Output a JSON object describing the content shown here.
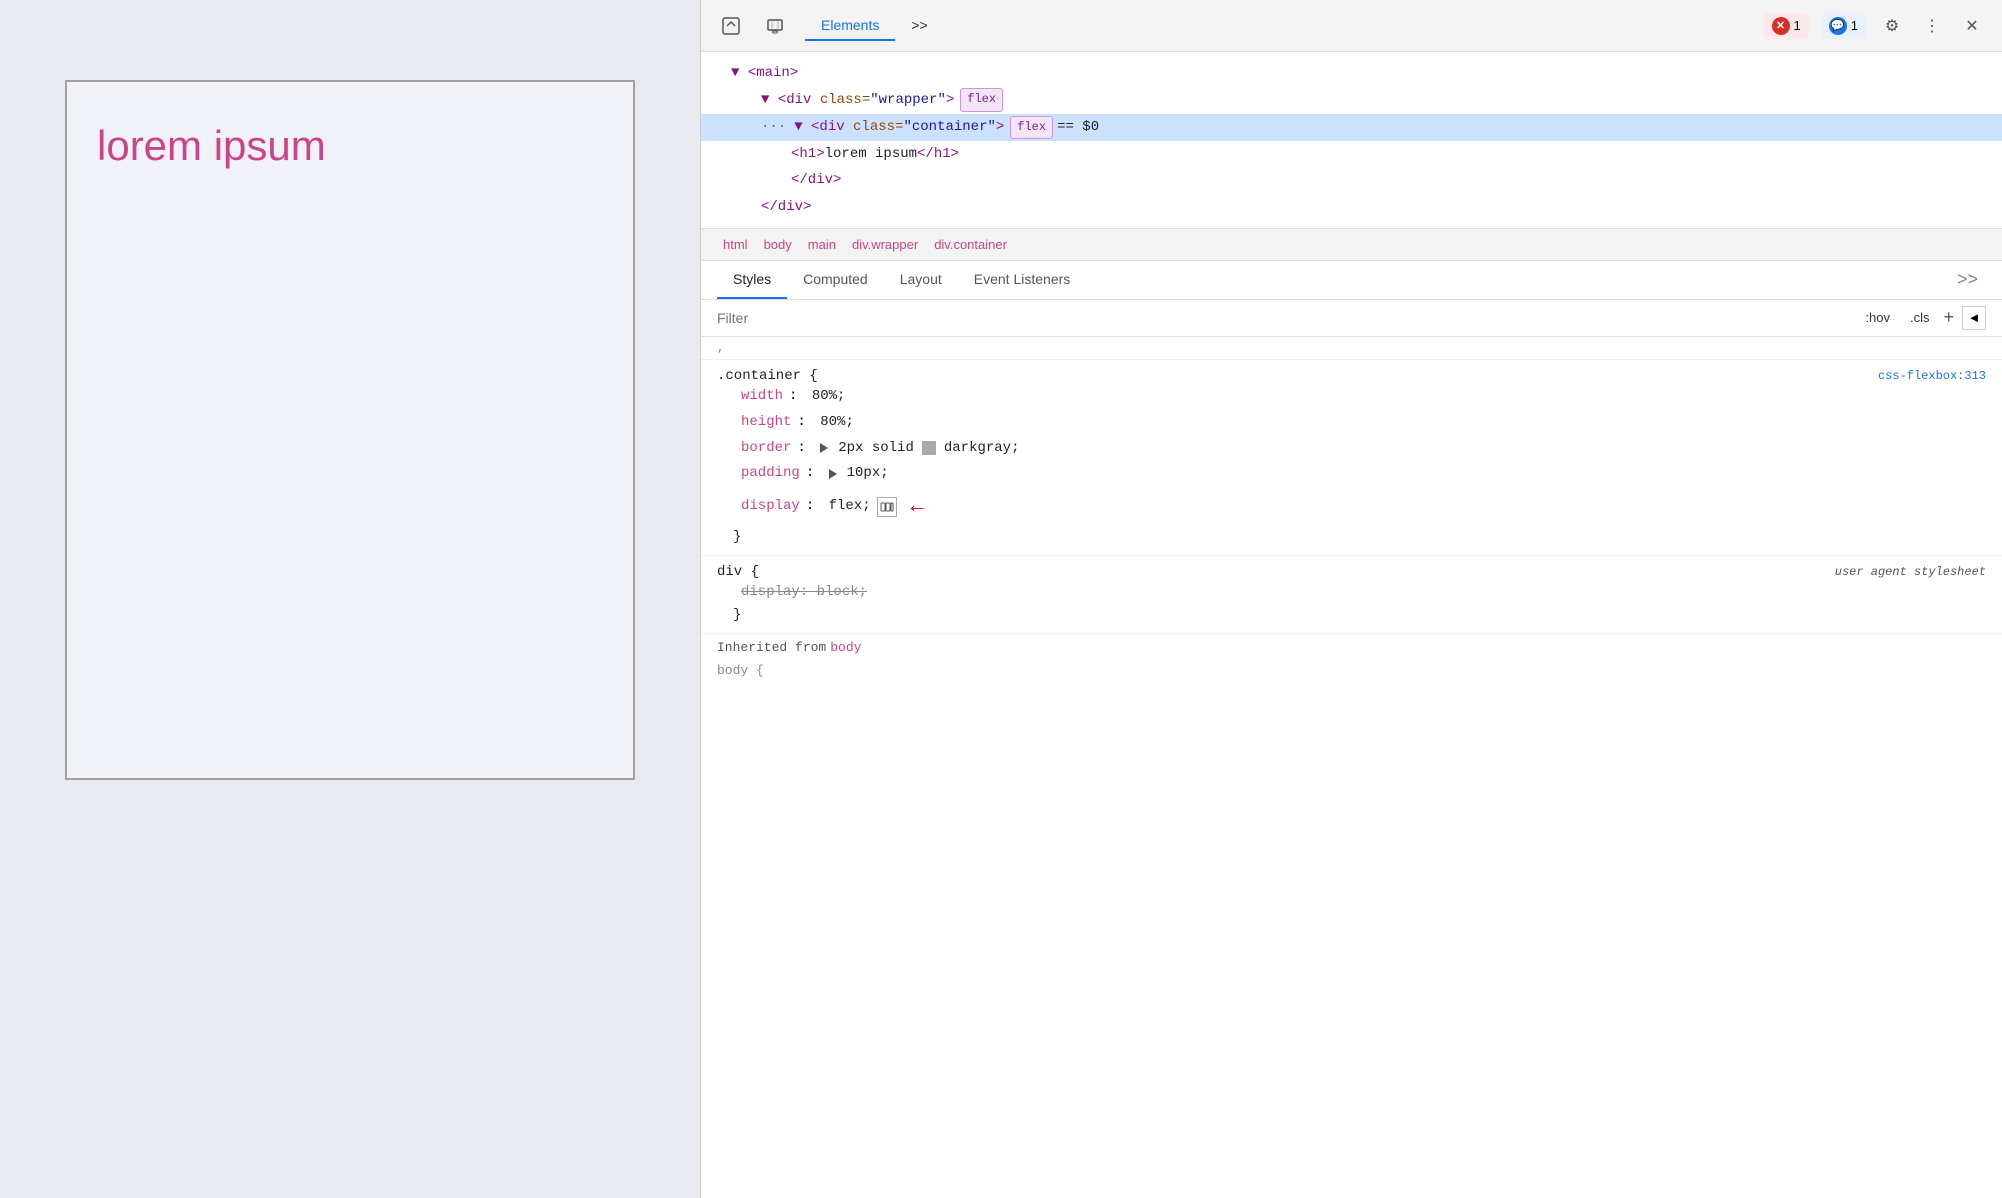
{
  "browser": {
    "viewport_heading": "lorem ipsum"
  },
  "devtools": {
    "toolbar": {
      "inspect_icon": "⬚",
      "device_icon": "📱",
      "tabs": [
        "Elements",
        ">>"
      ],
      "active_tab": "Elements",
      "error_count": "1",
      "msg_count": "1",
      "settings_icon": "⚙",
      "more_icon": "⋮",
      "close_icon": "✕"
    },
    "dom_tree": {
      "lines": [
        {
          "indent": 1,
          "content": "▼ <main>",
          "selected": false
        },
        {
          "indent": 2,
          "content": "▼ <div class=\"wrapper\">",
          "badge": "flex",
          "selected": false
        },
        {
          "indent": 2,
          "content": "▼ <div class=\"container\">",
          "badge": "flex",
          "selected": true,
          "dots": true,
          "eq": "== $0"
        },
        {
          "indent": 3,
          "content": "<h1>lorem ipsum</h1>",
          "selected": false
        },
        {
          "indent": 3,
          "content": "</div>",
          "selected": false
        },
        {
          "indent": 2,
          "content": "</div>",
          "selected": false
        }
      ]
    },
    "breadcrumb": {
      "items": [
        "html",
        "body",
        "main",
        "div.wrapper",
        "div.container"
      ]
    },
    "style_tabs": {
      "tabs": [
        "Styles",
        "Computed",
        "Layout",
        "Event Listeners",
        ">>"
      ],
      "active_tab": "Styles"
    },
    "filter": {
      "placeholder": "Filter",
      "hov_btn": ":hov",
      "cls_btn": ".cls",
      "plus_btn": "+",
      "arrow_btn": "◄"
    },
    "css_rules": [
      {
        "selector": ".container {",
        "source": "css-flexbox:313",
        "properties": [
          {
            "name": "width",
            "value": "80%;",
            "strikethrough": false
          },
          {
            "name": "height",
            "value": "80%;",
            "strikethrough": false
          },
          {
            "name": "border",
            "value": "► 2px solid",
            "color_swatch": "darkgray",
            "color_name": "darkgray;",
            "strikethrough": false
          },
          {
            "name": "padding",
            "value": "► 10px;",
            "strikethrough": false
          },
          {
            "name": "display",
            "value": "flex;",
            "has_flex_icon": true,
            "has_arrow": true,
            "strikethrough": false
          }
        ],
        "close": "}"
      },
      {
        "selector": "div {",
        "source_italic": "user agent stylesheet",
        "properties": [
          {
            "name": "display:",
            "value": "block;",
            "strikethrough": true
          }
        ],
        "close": "}"
      }
    ],
    "inherited": {
      "label": "Inherited from",
      "from": "body",
      "partial_selector": "body {"
    }
  }
}
